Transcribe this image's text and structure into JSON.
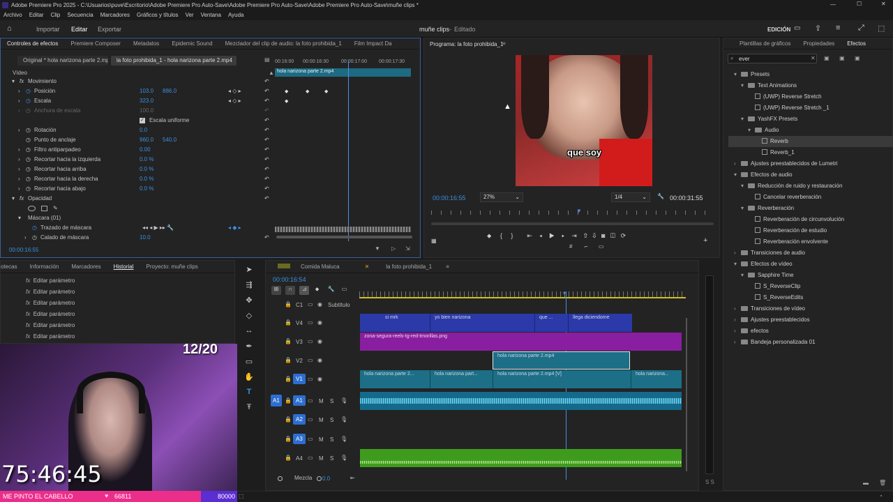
{
  "window": {
    "title": "Adobe Premiere Pro 2025 - C:\\Usuarios\\puve\\Escritorio\\Adobe Premiere Pro Auto-Save\\Adobe Premiere Pro Auto-Save\\Adobe Premiere Pro Auto-Save\\muñe clips *"
  },
  "menu": [
    "Archivo",
    "Editar",
    "Clip",
    "Secuencia",
    "Marcadores",
    "Gráficos y títulos",
    "Ver",
    "Ventana",
    "Ayuda"
  ],
  "header": {
    "tabs": [
      "Importar",
      "Editar",
      "Exportar"
    ],
    "center_title": "muñe clips",
    "center_status": "Editado",
    "workspace": "EDICIÓN"
  },
  "effect_controls": {
    "tabs": [
      "Controles de efectos",
      "Premiere Composer",
      "Metadatos",
      "Epidemic Sound",
      "Mezclador del clip de audio: la foto prohibida_1",
      "Film Impact Da"
    ],
    "master": "Original * hola narizona parte 2.mp4",
    "clip": "la foto prohibida_1 - hola narizona parte 2.mp4",
    "ruler": [
      "00:16:00",
      "00:00:16:30",
      "00:00:17:00",
      "00:00:17:30"
    ],
    "clip_bar": "hola narizona parte 2.mp4",
    "section": "Vídeo",
    "rows": [
      {
        "label": "Movimiento",
        "v1": "",
        "v2": ""
      },
      {
        "label": "Posición",
        "v1": "103.0",
        "v2": "886.0"
      },
      {
        "label": "Escala",
        "v1": "323.0",
        "v2": ""
      },
      {
        "label": "Anchura de escala",
        "v1": "100.0",
        "v2": ""
      },
      {
        "label": "Escala uniforme",
        "v1": "",
        "v2": ""
      },
      {
        "label": "Rotación",
        "v1": "0.0",
        "v2": ""
      },
      {
        "label": "Punto de anclaje",
        "v1": "960.0",
        "v2": "540.0"
      },
      {
        "label": "Filtro antiparpadeo",
        "v1": "0.00",
        "v2": ""
      },
      {
        "label": "Recortar hacia la izquierda",
        "v1": "0.0 %",
        "v2": ""
      },
      {
        "label": "Recortar hacia arriba",
        "v1": "0.0 %",
        "v2": ""
      },
      {
        "label": "Recortar hacia la derecha",
        "v1": "0.0 %",
        "v2": ""
      },
      {
        "label": "Recortar hacia abajo",
        "v1": "0.0 %",
        "v2": ""
      },
      {
        "label": "Opacidad",
        "v1": "",
        "v2": ""
      },
      {
        "label": "",
        "v1": "",
        "v2": ""
      },
      {
        "label": "Máscara (01)",
        "v1": "",
        "v2": ""
      },
      {
        "label": "Trazado de máscara",
        "v1": "",
        "v2": ""
      },
      {
        "label": "Calado de máscara",
        "v1": "10.0",
        "v2": ""
      }
    ],
    "timecode": "00:00:16:55"
  },
  "program": {
    "title": "Programa: la foto prohibida_1",
    "caption": "que soy",
    "timecode": "00:00:16:55",
    "zoom": "27%",
    "quality": "1/4",
    "duration": "00:00:31:55"
  },
  "effects_panel": {
    "tabs": [
      "Plantillas de gráficos",
      "Propiedades",
      "Efectos"
    ],
    "search": "ever",
    "tree": [
      {
        "label": "Presets",
        "level": 0,
        "kind": "folder",
        "open": true
      },
      {
        "label": "Text Animations",
        "level": 1,
        "kind": "folder",
        "open": true
      },
      {
        "label": "(UWP) Reverse Stretch",
        "level": 2,
        "kind": "fx"
      },
      {
        "label": "(UWP) Reverse Stretch _1",
        "level": 2,
        "kind": "fx"
      },
      {
        "label": "YashFX Presets",
        "level": 1,
        "kind": "folder",
        "open": true
      },
      {
        "label": "Audio",
        "level": 2,
        "kind": "folder",
        "open": true
      },
      {
        "label": "Reverb",
        "level": 3,
        "kind": "fx",
        "selected": true
      },
      {
        "label": "Reverb_1",
        "level": 3,
        "kind": "fx"
      },
      {
        "label": "Ajustes preestablecidos de Lumetri",
        "level": 0,
        "kind": "folder",
        "open": false
      },
      {
        "label": "Efectos de audio",
        "level": 0,
        "kind": "folder",
        "open": true
      },
      {
        "label": "Reducción de ruido y restauración",
        "level": 1,
        "kind": "folder",
        "open": true
      },
      {
        "label": "Cancelar reverberación",
        "level": 2,
        "kind": "fx"
      },
      {
        "label": "Reverberación",
        "level": 1,
        "kind": "folder",
        "open": true
      },
      {
        "label": "Reverberación de circunvolución",
        "level": 2,
        "kind": "fx"
      },
      {
        "label": "Reverberación de estudio",
        "level": 2,
        "kind": "fx"
      },
      {
        "label": "Reverberación envolvente",
        "level": 2,
        "kind": "fx"
      },
      {
        "label": "Transiciones de audio",
        "level": 0,
        "kind": "folder",
        "open": false
      },
      {
        "label": "Efectos de vídeo",
        "level": 0,
        "kind": "folder",
        "open": true
      },
      {
        "label": "Sapphire Time",
        "level": 1,
        "kind": "folder",
        "open": true
      },
      {
        "label": "S_ReverseClip",
        "level": 2,
        "kind": "fx"
      },
      {
        "label": "S_ReverseEdits",
        "level": 2,
        "kind": "fx"
      },
      {
        "label": "Transiciones de vídeo",
        "level": 0,
        "kind": "folder",
        "open": false
      },
      {
        "label": "Ajustes preestablecidos",
        "level": 0,
        "kind": "folder",
        "open": false
      },
      {
        "label": "efectos",
        "level": 0,
        "kind": "folder",
        "open": false
      },
      {
        "label": "Bandeja personalizada 01",
        "level": 0,
        "kind": "folder",
        "open": false
      }
    ]
  },
  "history": {
    "tabs": [
      "otecas",
      "Información",
      "Marcadores",
      "Historial",
      "Proyecto: muñe clips"
    ],
    "items": [
      "Editar parámetro",
      "Editar parámetro",
      "Editar parámetro",
      "Editar parámetro",
      "Editar parámetro",
      "Editar parámetro"
    ]
  },
  "timeline": {
    "tabs": [
      "Comida Maluca",
      "la foto prohibida_1"
    ],
    "timecode": "00:00:16:54",
    "c1": "Subtítulo",
    "tracks": [
      "C1",
      "V4",
      "V3",
      "V2",
      "V1",
      "A1",
      "A2",
      "A3",
      "A4"
    ],
    "mix_label": "Mezcla",
    "mix_value": "0.0",
    "clips": {
      "v4a": "si mrk",
      "v4b": "yo bien narizona",
      "v4c": "que ...",
      "v4d": "llega diciendome",
      "v3": "zona-segura-reels-tg-red-tmorillas.png",
      "v2": "hola narizona parte 2.mp4",
      "v1a": "hola narizona parte 2...",
      "v1b": "hola narizona part...",
      "v1c": "hola narizona parte 2.mp4 [V]",
      "v1d": "hola narizona..."
    }
  },
  "overlay": {
    "counter": "12/20",
    "clock": "75:46:45",
    "bottom_text": "ME PINTO EL CABELLO",
    "bottom_num1": "66811",
    "bottom_num2": "80000"
  },
  "colors": {
    "accent": "#2d8ceb",
    "v4": "#2b3aa8",
    "v3": "#8a1ea0",
    "video": "#1c6f86",
    "audio": "#136a8a",
    "a4": "#3f9b1e",
    "overlay_bar": "#ec2e8b"
  }
}
